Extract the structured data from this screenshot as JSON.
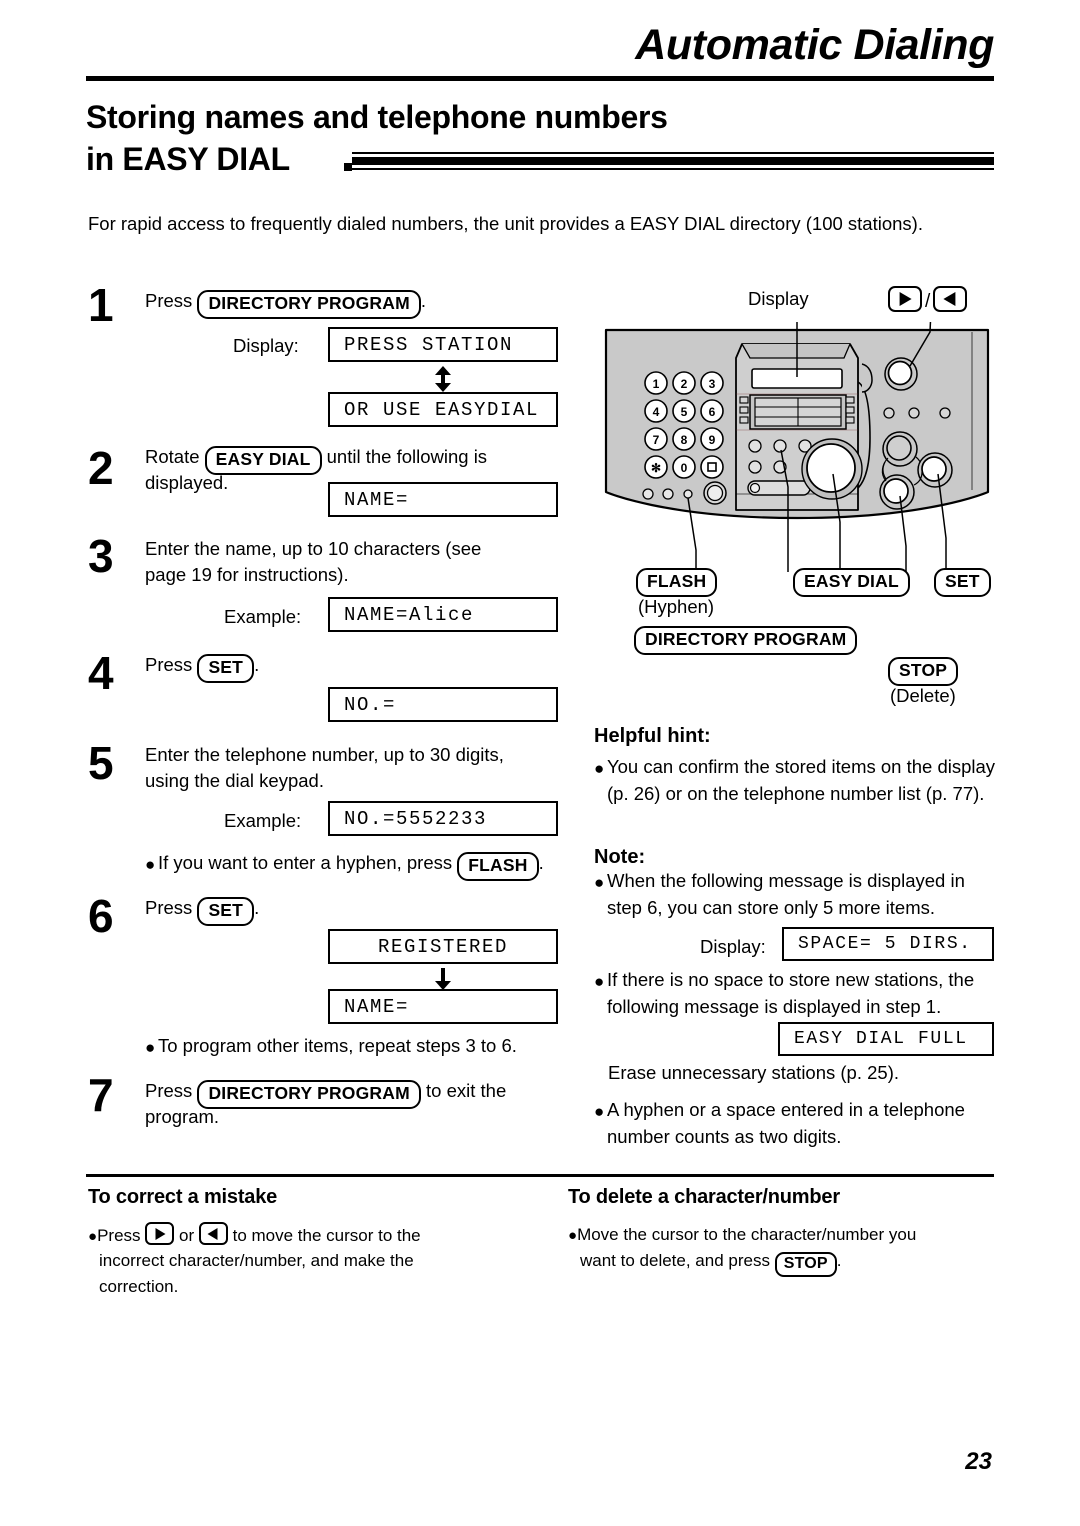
{
  "header": {
    "chapter": "Automatic Dialing",
    "section_line1": "Storing names and telephone numbers",
    "section_line2": "in EASY DIAL"
  },
  "intro": "For rapid access to frequently dialed numbers, the unit provides a EASY DIAL directory (100 stations).",
  "steps": [
    {
      "number": "1",
      "text_before": "Press",
      "key": "DIRECTORY PROGRAM",
      "text_after": ".",
      "display_label": "Display:",
      "lcd1": "PRESS STATION",
      "lcd2": "OR USE EASYDIAL"
    },
    {
      "number": "2",
      "text_before": "Rotate",
      "key": "EASY DIAL",
      "text_after": "until the following is",
      "text_line2": "displayed.",
      "lcd1": "NAME="
    },
    {
      "number": "3",
      "text_line1": "Enter the name, up to 10 characters (see",
      "text_line2": "page 19 for instructions).",
      "example_label": "Example:",
      "lcd1": "NAME=Alice"
    },
    {
      "number": "4",
      "text_before": "Press",
      "key": "SET",
      "text_after": ".",
      "lcd1": "NO.="
    },
    {
      "number": "5",
      "text_line1": "Enter the telephone number, up to 30 digits,",
      "text_line2": "using the dial keypad.",
      "example_label": "Example:",
      "lcd1": "NO.=5552233",
      "note_before": "If you want to enter a hyphen, press",
      "note_key": "FLASH",
      "note_after": "."
    },
    {
      "number": "6",
      "text_before": "Press",
      "key": "SET",
      "text_after": ".",
      "lcd1": "REGISTERED",
      "lcd2": "NAME=",
      "note": "To program other items, repeat steps 3 to 6."
    },
    {
      "number": "7",
      "text_before": "Press",
      "key": "DIRECTORY PROGRAM",
      "text_after": "to exit the",
      "text_line2": "program."
    }
  ],
  "device": {
    "display_callout": "Display",
    "arrow_callout_separator": "/",
    "keypad": [
      "1",
      "2",
      "3",
      "4",
      "5",
      "6",
      "7",
      "8",
      "9",
      "*",
      "0",
      "#"
    ],
    "labels": {
      "flash": "FLASH",
      "flash_sub": "(Hyphen)",
      "easy_dial": "EASY DIAL",
      "set": "SET",
      "directory_program": "DIRECTORY PROGRAM",
      "stop": "STOP",
      "stop_sub": "(Delete)"
    },
    "panel_color": "#c9c9c9"
  },
  "helpful_hint": {
    "title": "Helpful hint:",
    "items": [
      "You can confirm the stored items on the display (p. 26) or on the telephone number list (p. 77)."
    ]
  },
  "note": {
    "title": "Note:",
    "item1": "When the following message is displayed in step 6, you can store only 5 more items.",
    "item1_display_label": "Display:",
    "item1_lcd": "SPACE= 5 DIRS.",
    "item2": "If there is no space to store new stations, the following message is displayed in step 1.",
    "item2_lcd": "EASY DIAL FULL",
    "item2_after": "Erase unnecessary stations (p. 25).",
    "item3": "A hyphen or a space entered in a telephone number counts as two digits."
  },
  "bottom": {
    "left": {
      "title": "To correct a mistake",
      "line1_a": "Press",
      "line1_or": "or",
      "line1_b": "to move the cursor to the",
      "line2": "incorrect character/number, and make the",
      "line3": "correction."
    },
    "right": {
      "title": "To delete a character/number",
      "line1": "Move the cursor to the character/number you",
      "line2_a": "want to delete, and press",
      "line2_key": "STOP",
      "line2_b": "."
    }
  },
  "page_number": "23"
}
